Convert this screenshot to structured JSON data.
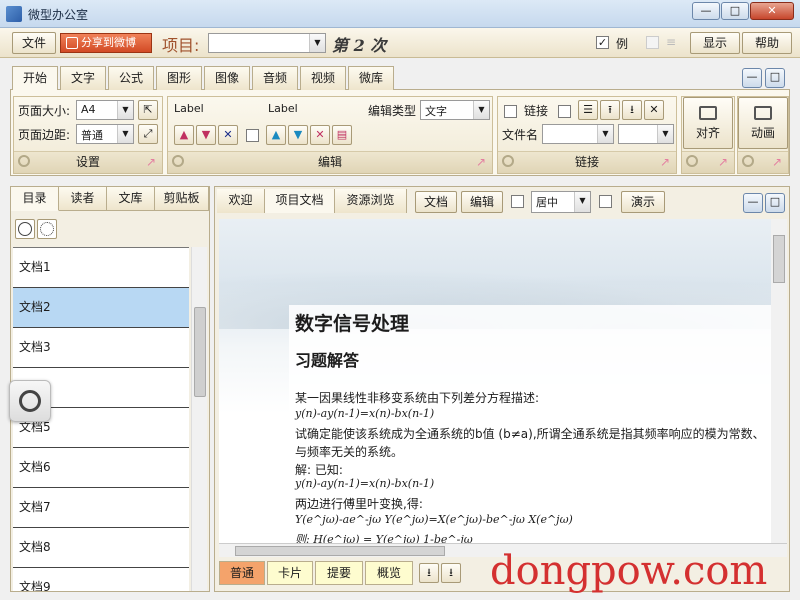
{
  "window": {
    "title": "微型办公室"
  },
  "toolbar": {
    "doc_button": "文件",
    "share_button": "分享到微博",
    "project_label": "项目:",
    "project_value": "",
    "sequence": "第 2 次",
    "example_checkbox_label": "例",
    "example_checked": true,
    "show_button": "显示",
    "help_button": "帮助"
  },
  "ribbon": {
    "tabs": [
      "开始",
      "文字",
      "公式",
      "图形",
      "图像",
      "音频",
      "视频",
      "微库"
    ],
    "active_tab": "开始",
    "settings": {
      "page_size_label": "页面大小:",
      "page_size_value": "A4",
      "page_margin_label": "页面边距:",
      "page_margin_value": "普通",
      "group_label": "设置"
    },
    "edit": {
      "label_1": "Label",
      "label_2": "Label",
      "edit_type_label": "编辑类型",
      "edit_type_value": "文字",
      "group_label": "编辑"
    },
    "link": {
      "link_label": "链接",
      "filename_label": "文件名",
      "group_label": "链接"
    },
    "align": {
      "label": "对齐"
    },
    "animation": {
      "label": "动画"
    }
  },
  "left_panel": {
    "tabs": [
      "目录",
      "读者",
      "文库",
      "剪贴板"
    ],
    "active_tab": "目录",
    "documents": [
      "文档1",
      "文档2",
      "文档3",
      "",
      "文档5",
      "文档6",
      "文档7",
      "文档8",
      "文档9"
    ],
    "selected_index": 1
  },
  "doc_panel": {
    "tabs": [
      "欢迎",
      "项目文档",
      "资源浏览"
    ],
    "active_tab": "项目文档",
    "doc_button": "文档",
    "edit_button": "编辑",
    "align_value": "居中",
    "present_button": "演示",
    "content": {
      "title": "数字信号处理",
      "subtitle": "习题解答",
      "lines": [
        "某一因果线性非移变系统由下列差分方程描述:",
        "y(n)-ay(n-1)=x(n)-bx(n-1)",
        "试确定能使该系统成为全通系统的b值 (b≠a),所谓全通系统是指其频率响应的模为常数、",
        "与频率无关的系统。",
        "解: 已知:",
        "y(n)-ay(n-1)=x(n)-bx(n-1)",
        "两边进行傅里叶变换,得:",
        "Y(e^jω)-ae^-jω Y(e^jω)=X(e^jω)-be^-jω X(e^jω)",
        "则: H(e^jω) = Y(e^jω) 1-be^-jω"
      ]
    },
    "view_tabs": [
      "普通",
      "卡片",
      "提要",
      "概览"
    ],
    "active_view": "普通"
  },
  "watermark": "dongpow.com"
}
